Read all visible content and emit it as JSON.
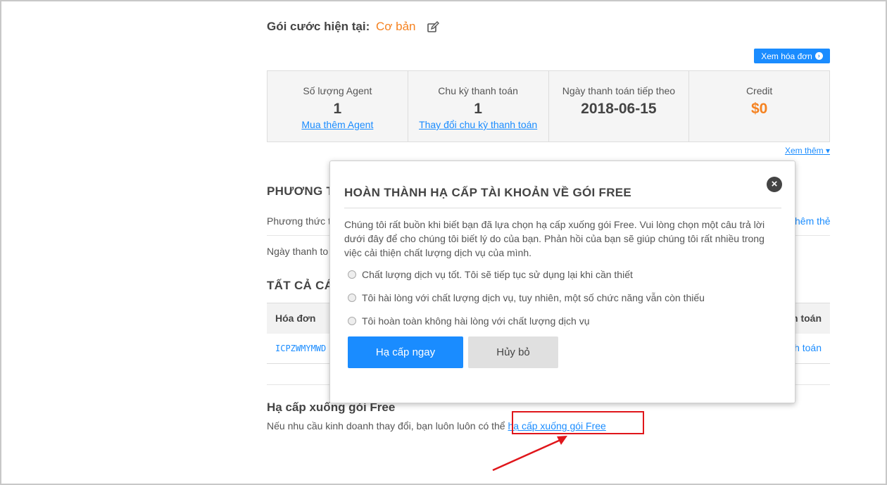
{
  "plan": {
    "label": "Gói cước hiện tại:",
    "name": "Cơ bản",
    "edit_icon": "edit-icon",
    "invoice_button": "Xem hóa đơn"
  },
  "stats": [
    {
      "label": "Số lượng Agent",
      "value": "1",
      "link": "Mua thêm Agent"
    },
    {
      "label": "Chu kỳ thanh toán",
      "value": "1",
      "link": "Thay đổi chu kỳ thanh toán"
    },
    {
      "label": "Ngày thanh toán tiếp theo",
      "value": "2018-06-15"
    },
    {
      "label": "Credit",
      "value": "$0"
    }
  ],
  "see_more": "Xem thêm",
  "background": {
    "payment_heading": "PHƯƠNG T",
    "payment_method": "Phương thức t",
    "add_card": "hêm thẻ",
    "payment_date": "Ngày thanh to",
    "invoices_heading": "TẤT CẢ CÁ",
    "table_headers": [
      "Hóa đơn",
      "h toán"
    ],
    "table_row": {
      "code": "ICPZWMYMWD",
      "action": "h toán"
    }
  },
  "downgrade": {
    "title": "Hạ cấp xuống gói Free",
    "text": "Nếu nhu cầu kinh doanh thay đổi, bạn luôn luôn có thể",
    "link": "hạ cấp xuống gói Free"
  },
  "modal": {
    "title": "HOÀN THÀNH HẠ CẤP TÀI KHOẢN VỀ GÓI FREE",
    "description": "Chúng tôi rất buồn khi biết bạn đã lựa chọn hạ cấp xuống gói Free. Vui lòng chọn một câu trả lời dưới đây để cho chúng tôi biết lý do của bạn. Phản hồi của bạn sẽ giúp chúng tôi rất nhiều trong việc cải thiện chất lượng dịch vụ của mình.",
    "options": [
      "Chất lượng dịch vụ tốt. Tôi sẽ tiếp tục sử dụng lại khi cần thiết",
      "Tôi hài lòng với chất lượng dịch vụ, tuy nhiên, một số chức năng vẫn còn thiếu",
      "Tôi hoàn toàn không hài lòng với chất lượng dịch vụ"
    ],
    "confirm_button": "Hạ cấp ngay",
    "cancel_button": "Hủy bỏ"
  },
  "colors": {
    "accent": "#1a8cff",
    "orange": "#f58220",
    "annotation_red": "#e0161b"
  }
}
